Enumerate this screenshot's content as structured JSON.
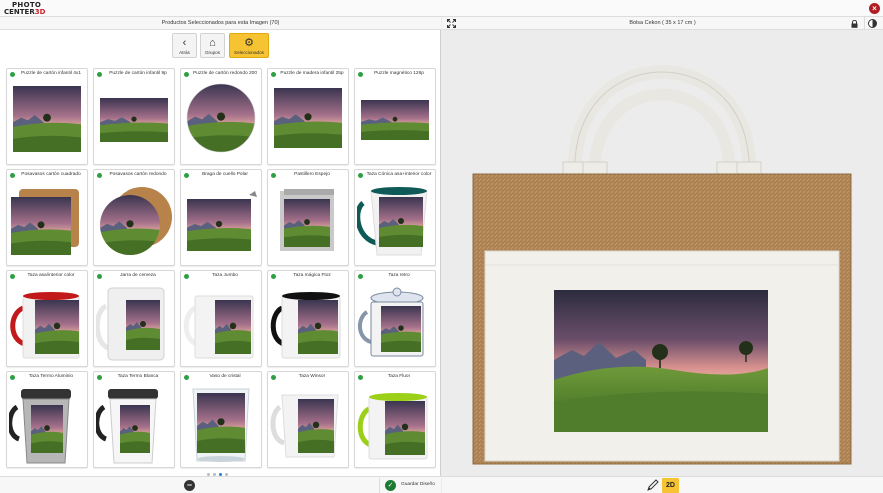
{
  "app": {
    "logo_line1": "PHOTO",
    "logo_line2": "CENTER",
    "logo_line2_accent": "3D"
  },
  "left": {
    "header_title": "Productos Seleccionados para esta Imagen (70)",
    "nav": [
      {
        "label": "Atrás",
        "icon": "chevron-left-icon",
        "glyph": "‹"
      },
      {
        "label": "Grupos",
        "icon": "home-icon",
        "glyph": "⌂"
      },
      {
        "label": "Seleccionados",
        "icon": "gear-icon",
        "glyph": "⚙"
      }
    ],
    "products": [
      {
        "name": "Puzzle de cartón infantil 4x1",
        "kind": "puzzle-rect"
      },
      {
        "name": "Puzzle de cartón infantil 9p",
        "kind": "puzzle-small"
      },
      {
        "name": "Puzzle de cartón redondo 200",
        "kind": "puzzle-round"
      },
      {
        "name": "Puzzle de madera infantil 25p",
        "kind": "puzzle-wood"
      },
      {
        "name": "Puzzle magnético 126p",
        "kind": "puzzle-mag"
      },
      {
        "name": "Posavasos cartón cuadrado",
        "kind": "coaster-square"
      },
      {
        "name": "Posavasos cartón redondo",
        "kind": "coaster-round"
      },
      {
        "name": "Braga de cuello Polar",
        "kind": "neck"
      },
      {
        "name": "Pastillero Espejo",
        "kind": "pillbox"
      },
      {
        "name": "Taza Cónica asa+interior color",
        "kind": "mug-cone"
      },
      {
        "name": "Taza asa/interior color",
        "kind": "mug-red"
      },
      {
        "name": "Jarra de cerveza",
        "kind": "beer"
      },
      {
        "name": "Taza Jumbo",
        "kind": "mug-white"
      },
      {
        "name": "Taza mágica Ftoz",
        "kind": "mug-black"
      },
      {
        "name": "Taza retro",
        "kind": "mug-retro"
      },
      {
        "name": "Taza Termo Aluminio",
        "kind": "thermo-alu"
      },
      {
        "name": "Taza Termo Blanca",
        "kind": "thermo-white"
      },
      {
        "name": "Vaso de cristal",
        "kind": "glass"
      },
      {
        "name": "Taza Winsor",
        "kind": "mug-winsor"
      },
      {
        "name": "Taza Fluor",
        "kind": "mug-fluor"
      }
    ],
    "pager": {
      "count": 4,
      "active": 2
    },
    "save_label": "Guardar Diseño"
  },
  "right": {
    "header_title": "Bolsa Cekon ( 35 x 17 cm )",
    "mode_label": "2D"
  },
  "colors": {
    "accent_yellow": "#f6c332",
    "status_green": "#2ea043",
    "close_red": "#b01e24"
  }
}
